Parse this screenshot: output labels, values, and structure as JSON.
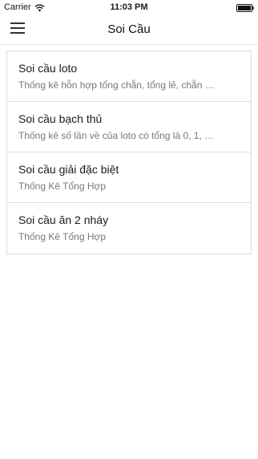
{
  "status_bar": {
    "carrier": "Carrier",
    "time": "11:03 PM",
    "wifi_icon": "wifi-icon",
    "battery_icon": "battery-icon"
  },
  "nav": {
    "menu_icon": "hamburger-menu-icon",
    "title": "Soi Cầu"
  },
  "list": {
    "items": [
      {
        "title": "Soi cầu loto",
        "subtitle": "Thống kê hỗn hợp tổng chẵn, tổng lẻ, chẵn …"
      },
      {
        "title": "Soi cầu bạch thủ",
        "subtitle": "Thống kê số lần về của loto có tổng là 0, 1, …"
      },
      {
        "title": "Soi cầu giải đặc biệt",
        "subtitle": "Thống Kê Tổng Hợp"
      },
      {
        "title": "Soi cầu ăn 2 nháy",
        "subtitle": "Thống Kê Tổng Hợp"
      }
    ]
  }
}
